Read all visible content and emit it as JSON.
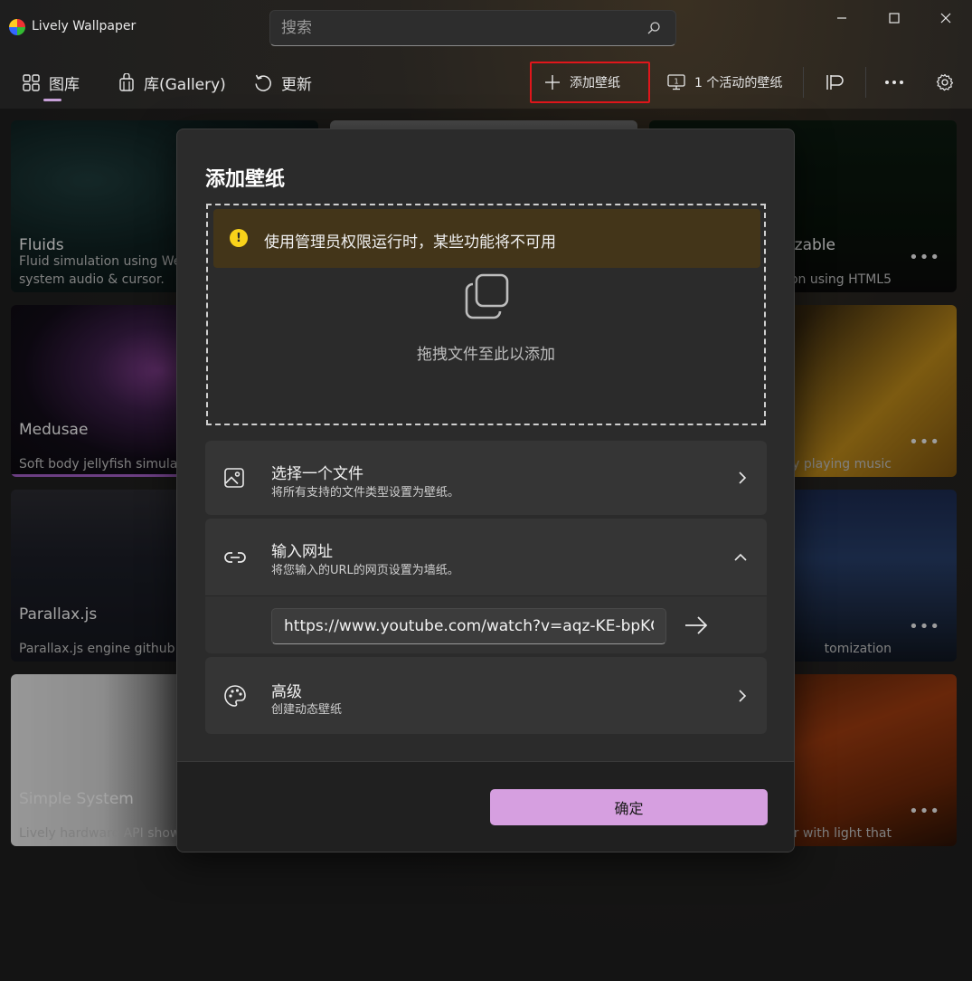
{
  "app": {
    "title": "Lively Wallpaper"
  },
  "search": {
    "placeholder": "搜索"
  },
  "nav": {
    "library": "图库",
    "gallery": "库(Gallery)",
    "update": "更新"
  },
  "toolbar": {
    "add_wallpaper": "添加壁纸",
    "active_wallpapers": "1 个活动的壁纸",
    "monitor_number": "1"
  },
  "tiles": [
    {
      "title": "Fluids",
      "desc_line1": "Fluid simulation using Web",
      "desc_line2": "system audio & cursor."
    },
    {
      "title": "Medusae",
      "desc_line1": "Soft body jellyfish simulati",
      "desc_line2": ""
    },
    {
      "title": "Parallax.js",
      "desc_line1": "Parallax.js engine github pa",
      "desc_line2": ""
    },
    {
      "title": "Simple System",
      "desc_line1": "Lively hardware API showc",
      "desc_line2": ""
    },
    {
      "title": "izable",
      "desc_line1": "on using HTML5",
      "desc_line2": ""
    },
    {
      "title": "",
      "desc_line1": "y playing music",
      "desc_line2": ""
    },
    {
      "title": "",
      "desc_line1": "tomization",
      "desc_line2": ""
    },
    {
      "title": "",
      "desc_line1": "ator with light that",
      "desc_line2": ""
    }
  ],
  "more_glyph": "•••",
  "dialog": {
    "title": "添加壁纸",
    "warning": "使用管理员权限运行时，某些功能将不可用",
    "warning_glyph": "!",
    "drop_text": "拖拽文件至此以添加",
    "choose_file": {
      "title": "选择一个文件",
      "subtitle": "将所有支持的文件类型设置为壁纸。"
    },
    "enter_url": {
      "title": "输入网址",
      "subtitle": "将您输入的URL的网页设置为墙纸。",
      "value": "https://www.youtube.com/watch?v=aqz-KE-bpKQ"
    },
    "advanced": {
      "title": "高级",
      "subtitle": "创建动态壁纸"
    },
    "ok": "确定"
  },
  "colors": {
    "accent": "#d69fe0",
    "selection": "#9e5cc0",
    "warning_bg": "#433519",
    "warning_icon": "#f9d21a",
    "highlight_box": "#e0161b"
  }
}
